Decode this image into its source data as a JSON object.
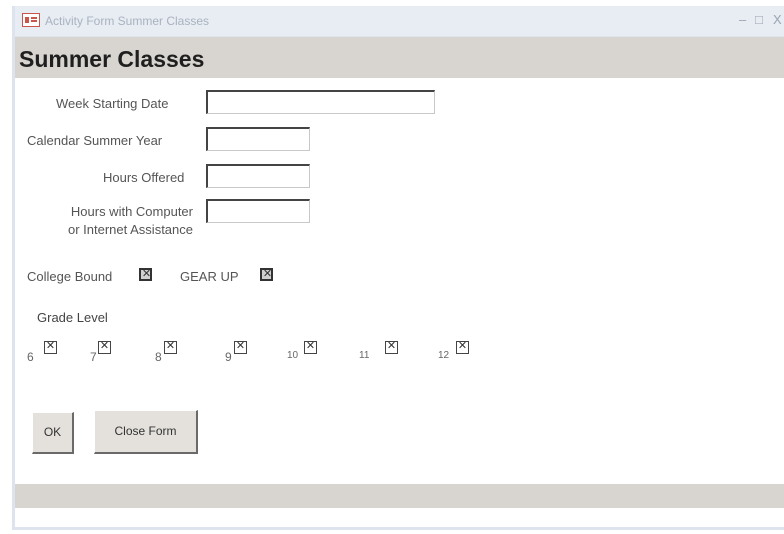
{
  "window": {
    "title": "Activity Form Summer Classes",
    "minimize_glyph": "–",
    "maximize_glyph": "□",
    "close_glyph": "X",
    "app_icon": "form-icon"
  },
  "form": {
    "heading": "Summer Classes",
    "fields": {
      "week_start_label": "Week Starting Date",
      "week_start_value": "",
      "year_label": "Calendar Summer Year",
      "year_value": "",
      "hours_label": "Hours Offered",
      "hours_value": "",
      "hours_computer_label_line1": "Hours with Computer",
      "hours_computer_label_line2": "or Internet Assistance",
      "hours_computer_value": ""
    },
    "checks": {
      "college_bound_label": "College Bound",
      "gear_up_label": "GEAR UP"
    },
    "grade_level": {
      "label": "Grade Level",
      "grades": [
        "6",
        "7",
        "8",
        "9",
        "10",
        "11",
        "12"
      ]
    },
    "buttons": {
      "ok": "OK",
      "close": "Close Form"
    }
  },
  "colors": {
    "header_band": "#d8d4cf",
    "titlebar": "#e8edf4",
    "button_face": "#e4e1dc"
  }
}
